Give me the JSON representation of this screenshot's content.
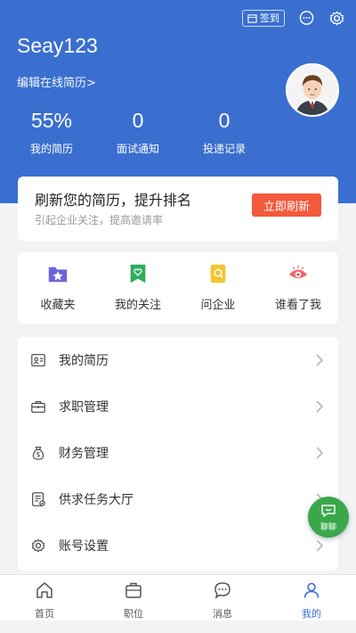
{
  "header": {
    "signin_label": "签到",
    "username": "Seay123",
    "edit_link": "编辑在线简历>"
  },
  "stats": [
    {
      "value": "55%",
      "label": "我的简历"
    },
    {
      "value": "0",
      "label": "面试通知"
    },
    {
      "value": "0",
      "label": "投递记录"
    }
  ],
  "refresh": {
    "title": "刷新您的简历，提升排名",
    "subtitle": "引起企业关注，提高邀请率",
    "button": "立即刷新"
  },
  "quick": [
    {
      "label": "收藏夹",
      "icon": "favorites-folder-icon"
    },
    {
      "label": "我的关注",
      "icon": "bookmark-heart-icon"
    },
    {
      "label": "问企业",
      "icon": "ask-company-icon"
    },
    {
      "label": "谁看了我",
      "icon": "eye-icon"
    }
  ],
  "menu": [
    {
      "label": "我的简历",
      "icon": "resume-icon"
    },
    {
      "label": "求职管理",
      "icon": "briefcase-icon"
    },
    {
      "label": "财务管理",
      "icon": "money-bag-icon"
    },
    {
      "label": "供求任务大厅",
      "icon": "task-list-icon"
    },
    {
      "label": "账号设置",
      "icon": "gear-icon"
    }
  ],
  "chat_fab": {
    "label": "聊聊"
  },
  "tabs": [
    {
      "label": "首页",
      "icon": "home-icon"
    },
    {
      "label": "职位",
      "icon": "briefcase-icon"
    },
    {
      "label": "消息",
      "icon": "message-icon"
    },
    {
      "label": "我的",
      "icon": "user-icon",
      "active": true
    }
  ],
  "colors": {
    "brand": "#3a6fd0",
    "accent_button": "#f25a3c",
    "chat_fab": "#3aa84a"
  }
}
